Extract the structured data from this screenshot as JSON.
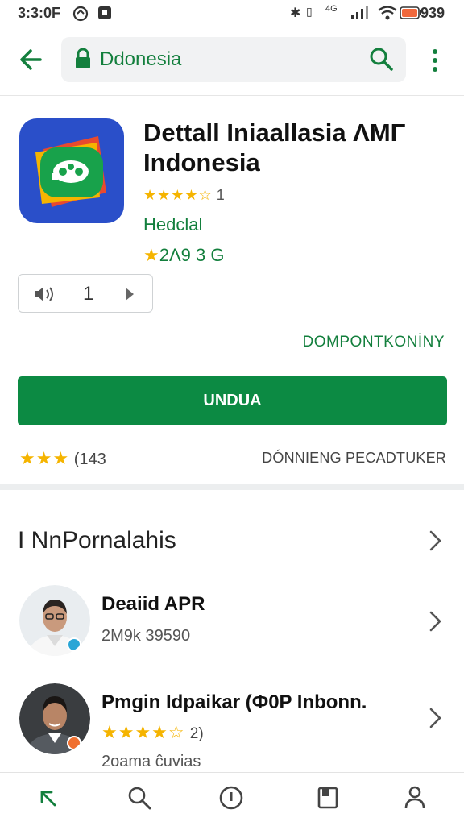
{
  "status_bar": {
    "time": "3:3:0F",
    "right_text": "939",
    "signal_text": "4G"
  },
  "search": {
    "query": "Ddonesia"
  },
  "app": {
    "title_line1": "Dettall Iniaallasia ΛΜΓ",
    "title_line2": "Indonesia",
    "rating_count": "1",
    "developer": "Hedclal",
    "meta": "2Λ9 3 G",
    "quantity": "1",
    "compat_label": "DOMPONTKONİNY",
    "install_label": "UNDUA",
    "footer_count": "(143",
    "footer_right": "DÓNNIENG PECADTUKER",
    "colors": {
      "brand_green": "#0c8a43",
      "text_green": "#137f3d",
      "star": "#f5b400"
    }
  },
  "section": {
    "title": "I NnPornalahis",
    "items": [
      {
        "name": "Deaiid APR",
        "sub": "2M9k 39590",
        "avatar_icon": "person-avatar-icon",
        "badge_icon": "info-badge-icon"
      },
      {
        "name": "Pmgin Idpaikar (Ф0P Inbonn.",
        "rating_text": "2)",
        "sub": "2oama ĉuvias",
        "avatar_icon": "person-avatar-icon",
        "badge_icon": "orange-badge-icon"
      }
    ]
  },
  "bottom_nav": [
    "back-arrow-icon",
    "search-icon",
    "info-icon",
    "bookmark-icon",
    "account-icon"
  ]
}
